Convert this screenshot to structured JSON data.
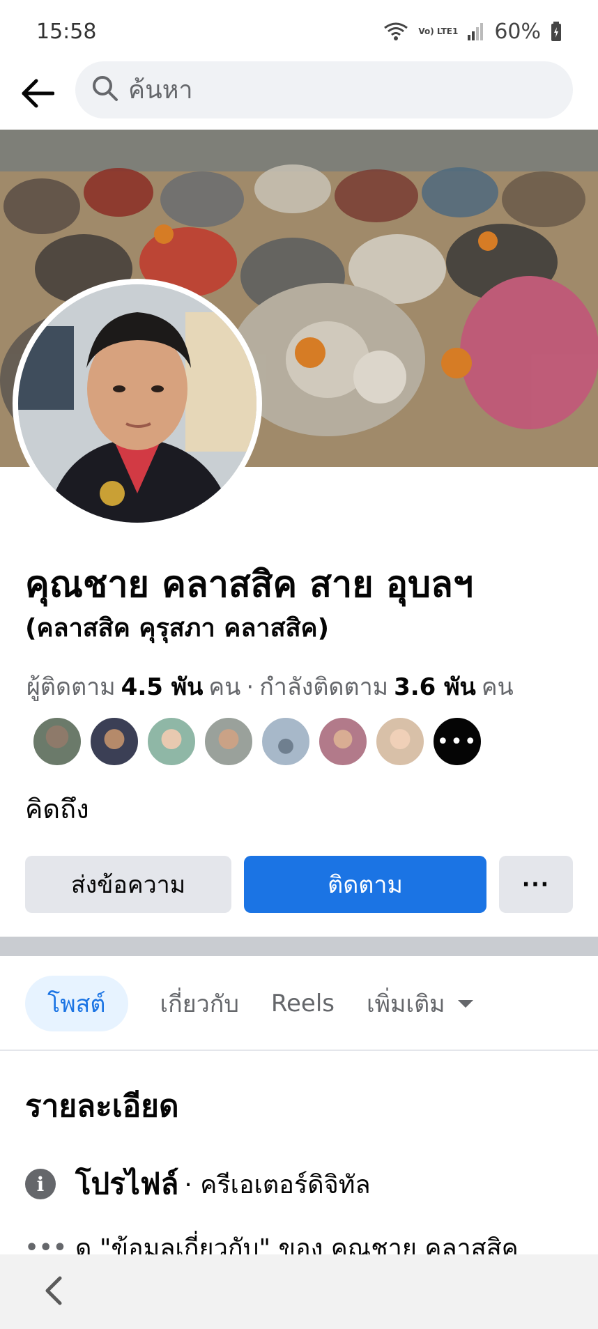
{
  "status_bar": {
    "time": "15:58",
    "network_label": "Vo) LTE1",
    "battery": "60%"
  },
  "header": {
    "search_placeholder": "ค้นหา"
  },
  "profile": {
    "name": "คุณชาย คลาสสิค สาย อุบลฯ",
    "alternate_name": "(คลาสสิค คุรุสภา คลาสสิค)",
    "followers_label": "ผู้ติดตาม",
    "followers_count": "4.5 พัน",
    "followers_unit": "คน",
    "separator": "·",
    "following_label": "กำลังติดตาม",
    "following_count": "3.6 พัน",
    "following_unit": "คน",
    "bio": "คิดถึง",
    "friend_avatar_colors": [
      "#6b7a6a",
      "#3b3f55",
      "#8fb7a6",
      "#9aa19b",
      "#a7b8c9",
      "#b27a8a",
      "#d8c0a8"
    ]
  },
  "actions": {
    "message_label": "ส่งข้อความ",
    "follow_label": "ติดตาม",
    "more_label": "···"
  },
  "tabs": [
    {
      "label": "โพสต์",
      "active": true
    },
    {
      "label": "เกี่ยวกับ",
      "active": false
    },
    {
      "label": "Reels",
      "active": false
    },
    {
      "label": "เพิ่มเติม",
      "active": false
    }
  ],
  "details": {
    "title": "รายละเอียด",
    "profile_label": "โปรไฟล์",
    "profile_type": "· ครีเอเตอร์ดิจิทัล",
    "about_text": "ดู \"ข้อมูลเกี่ยวกับ\" ของ คุณชาย คลาสสิค"
  },
  "colors": {
    "accent": "#1b74e4",
    "accent_light": "#e7f3ff",
    "button_gray": "#e4e6eb",
    "text_secondary": "#65676b"
  },
  "icons": [
    "back-arrow-icon",
    "search-icon",
    "wifi-icon",
    "signal-icon",
    "battery-icon",
    "info-icon",
    "more-dots-icon",
    "caret-down-icon",
    "nav-back-icon"
  ]
}
